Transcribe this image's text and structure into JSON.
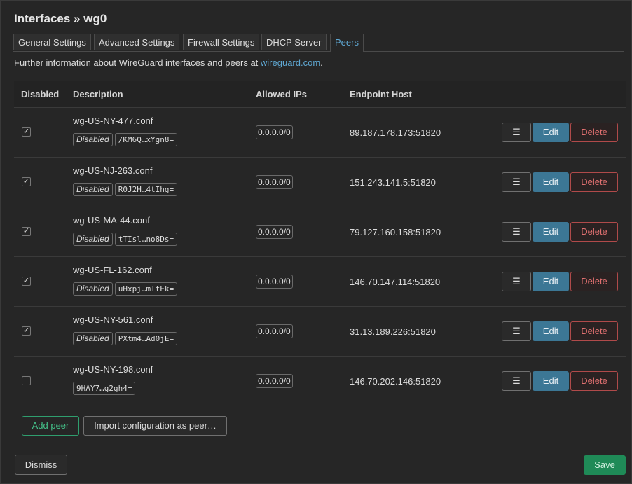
{
  "modal": {
    "title": "Interfaces » wg0",
    "tabs": [
      "General Settings",
      "Advanced Settings",
      "Firewall Settings",
      "DHCP Server",
      "Peers"
    ],
    "active_tab": "Peers",
    "info_text": "Further information about WireGuard interfaces and peers at ",
    "info_link": "wireguard.com",
    "info_suffix": ".",
    "colors": {
      "accent": "#5fa8d3",
      "edit": "#3c7795",
      "delete": "#e07070",
      "save": "#1f8a57",
      "add": "#44c28a"
    }
  },
  "table": {
    "headers": {
      "disabled": "Disabled",
      "description": "Description",
      "allowed_ips": "Allowed IPs",
      "endpoint": "Endpoint Host"
    },
    "rows": [
      {
        "disabled": true,
        "name": "wg-US-NY-477.conf",
        "badge": "Disabled",
        "key": "/KM6Q…xYgn8=",
        "allowed": "0.0.0.0/0",
        "endpoint": "89.187.178.173:51820"
      },
      {
        "disabled": true,
        "name": "wg-US-NJ-263.conf",
        "badge": "Disabled",
        "key": "R0J2H…4tIhg=",
        "allowed": "0.0.0.0/0",
        "endpoint": "151.243.141.5:51820"
      },
      {
        "disabled": true,
        "name": "wg-US-MA-44.conf",
        "badge": "Disabled",
        "key": "tTIsl…no8Ds=",
        "allowed": "0.0.0.0/0",
        "endpoint": "79.127.160.158:51820"
      },
      {
        "disabled": true,
        "name": "wg-US-FL-162.conf",
        "badge": "Disabled",
        "key": "uHxpj…mItEk=",
        "allowed": "0.0.0.0/0",
        "endpoint": "146.70.147.114:51820"
      },
      {
        "disabled": true,
        "name": "wg-US-NY-561.conf",
        "badge": "Disabled",
        "key": "PXtm4…Ad0jE=",
        "allowed": "0.0.0.0/0",
        "endpoint": "31.13.189.226:51820"
      },
      {
        "disabled": false,
        "name": "wg-US-NY-198.conf",
        "badge": "",
        "key": "9HAY7…g2gh4=",
        "allowed": "0.0.0.0/0",
        "endpoint": "146.70.202.146:51820"
      }
    ],
    "actions": {
      "menu_icon": "☰",
      "edit": "Edit",
      "delete": "Delete"
    }
  },
  "footer": {
    "add_peer": "Add peer",
    "import": "Import configuration as peer…",
    "dismiss": "Dismiss",
    "save": "Save"
  }
}
